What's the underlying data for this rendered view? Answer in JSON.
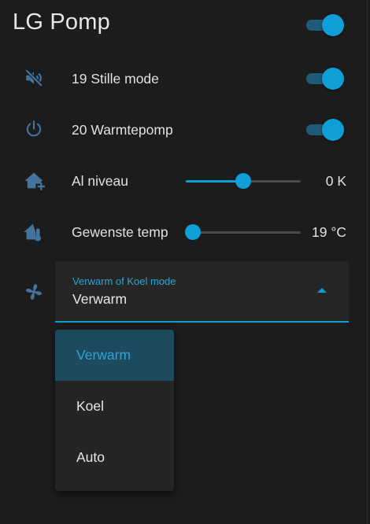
{
  "card": {
    "title": "LG Pomp",
    "master_toggle_on": true
  },
  "rows": [
    {
      "label": "19 Stille mode",
      "icon": "volume-off-icon",
      "toggle_on": true
    },
    {
      "label": "20 Warmtepomp",
      "icon": "power-icon",
      "toggle_on": true
    }
  ],
  "sliders": [
    {
      "label": "Al niveau",
      "icon": "home-plus-icon",
      "value_text": "0 K",
      "level_fraction": 0.5
    },
    {
      "label": "Gewenste temp",
      "icon": "home-thermometer-icon",
      "value_text": "19 °C",
      "level_fraction": 0.0
    }
  ],
  "select": {
    "icon": "fan-icon",
    "label": "Verwarm of Koel mode",
    "value": "Verwarm",
    "options": [
      "Verwarm",
      "Koel",
      "Auto"
    ],
    "selected_index": 0
  },
  "colors": {
    "accent": "#0e9fd6",
    "icon": "#44739e",
    "background": "#1c1c1c",
    "selected_option_bg": "#1c4a5e"
  }
}
